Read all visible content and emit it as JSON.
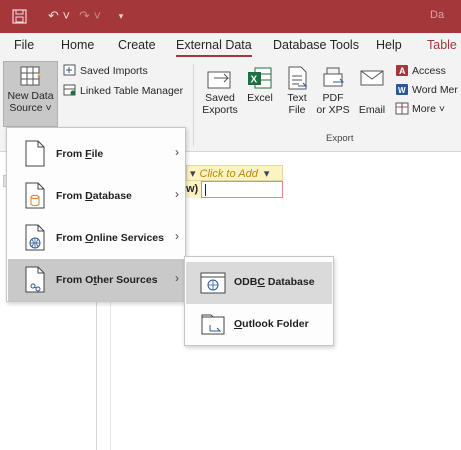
{
  "quick_access": {
    "save_icon": "save-icon",
    "undo_icon": "undo-icon",
    "redo_icon": "redo-icon",
    "customize_icon": "customize-toolbar-icon",
    "title_fragment": "Da"
  },
  "tabs": [
    {
      "label": "File"
    },
    {
      "label": "Home"
    },
    {
      "label": "Create"
    },
    {
      "label": "External Data"
    },
    {
      "label": "Database Tools"
    },
    {
      "label": "Help"
    },
    {
      "label": "Table F"
    }
  ],
  "ribbon": {
    "new_data_source": {
      "line1": "New Data",
      "line2": "Source ˅"
    },
    "saved_imports": "Saved Imports",
    "linked_table_manager": "Linked Table Manager",
    "saved_exports": {
      "line1": "Saved",
      "line2": "Exports"
    },
    "excel": "Excel",
    "text_file": {
      "line1": "Text",
      "line2": "File"
    },
    "pdf_xps": {
      "line1": "PDF",
      "line2": "or XPS"
    },
    "email": "Email",
    "access": "Access",
    "word_merge": "Word Mer",
    "more": "More ˅",
    "export_group": "Export"
  },
  "datasheet": {
    "click_to_add": "Click to Add",
    "dropdown_glyph": "▾",
    "new_row_fragment": "w)"
  },
  "menu": {
    "items": [
      {
        "label_pre": "From ",
        "label_ul": "F",
        "label_post": "ile",
        "arrow": "›"
      },
      {
        "label_pre": "From ",
        "label_ul": "D",
        "label_post": "atabase",
        "arrow": "›"
      },
      {
        "label_pre": "From ",
        "label_ul": "O",
        "label_post": "nline Services",
        "arrow": "›"
      },
      {
        "label_pre": "From O",
        "label_ul": "t",
        "label_post": "her Sources",
        "arrow": "›"
      }
    ]
  },
  "submenu": {
    "items": [
      {
        "label_pre": "ODB",
        "label_ul": "C",
        "label_post": " Database"
      },
      {
        "label_pre": "",
        "label_ul": "O",
        "label_post": "utlook Folder"
      }
    ]
  },
  "colors": {
    "accent": "#a4373a",
    "excel_green": "#1d6f42",
    "access_red": "#a4373a",
    "word_blue": "#2b579a"
  }
}
